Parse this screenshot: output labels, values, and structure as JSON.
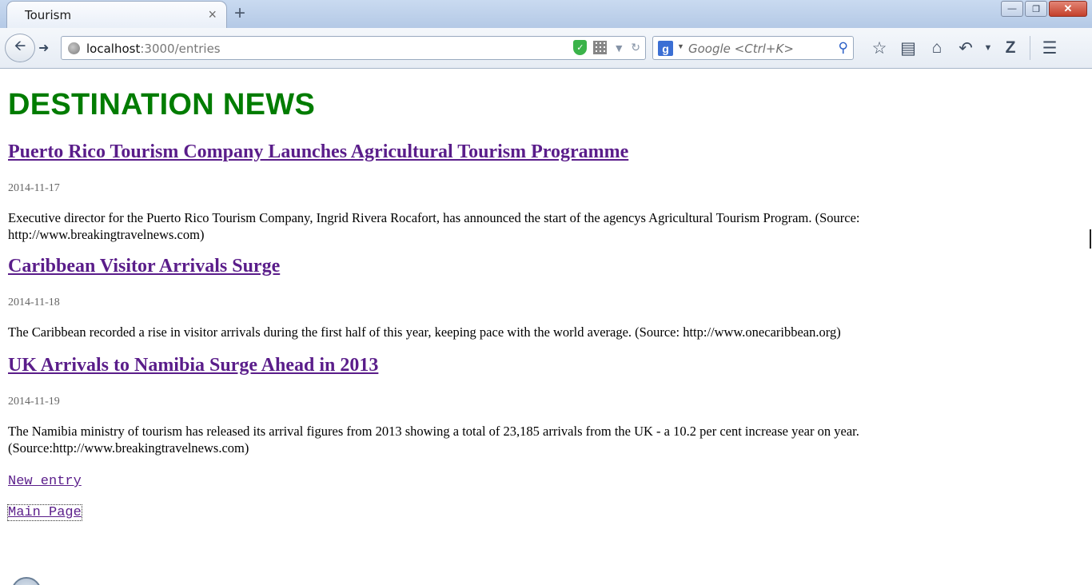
{
  "browser": {
    "tab": {
      "title": "Tourism",
      "close_glyph": "×"
    },
    "new_tab_glyph": "+",
    "window_controls": {
      "minimize": "—",
      "restore": "❐",
      "close": "✕"
    },
    "url": {
      "host": "localhost",
      "path": ":3000/entries"
    },
    "search": {
      "placeholder": "Google <Ctrl+K>",
      "engine_letter": "g"
    }
  },
  "page": {
    "heading": "DESTINATION NEWS",
    "entries": [
      {
        "title": "Puerto Rico Tourism Company Launches Agricultural Tourism Programme",
        "date": "2014-11-17",
        "body": "Executive director for the Puerto Rico Tourism Company, Ingrid Rivera Rocafort, has announced the start of the agencys Agricultural Tourism Program. (Source: http://www.breakingtravelnews.com)"
      },
      {
        "title": "Caribbean Visitor Arrivals Surge",
        "date": "2014-11-18",
        "body": "The Caribbean recorded a rise in visitor arrivals during the first half of this year, keeping pace with the world average. (Source: http://www.onecaribbean.org)"
      },
      {
        "title": "UK Arrivals to Namibia Surge Ahead in 2013",
        "date": "2014-11-19",
        "body": "The Namibia ministry of tourism has released its arrival figures from 2013 showing a total of 23,185 arrivals from the UK - a 10.2 per cent increase year on year. (Source:http://www.breakingtravelnews.com)"
      }
    ],
    "links": {
      "new_entry": "New entry",
      "main_page": "Main Page"
    }
  },
  "colors": {
    "heading": "#007c00",
    "link": "#5a1d8a"
  }
}
